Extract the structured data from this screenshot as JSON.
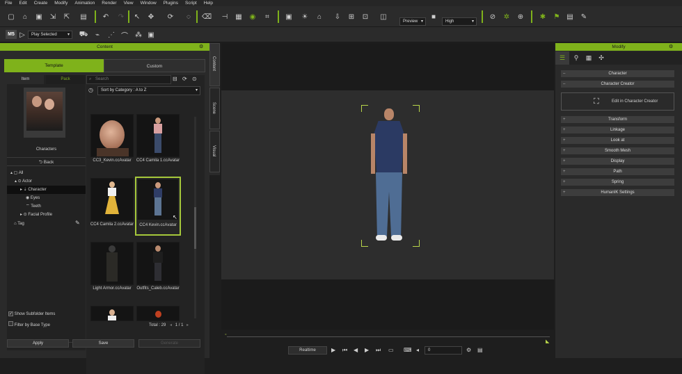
{
  "menu": [
    "File",
    "Edit",
    "Create",
    "Modify",
    "Animation",
    "Render",
    "View",
    "Window",
    "Plugins",
    "Script",
    "Help"
  ],
  "toolbar": {
    "preview_dropdown": "Preview",
    "quality_dropdown": "High",
    "play_selected_dropdown": "Play Selected",
    "logo": "M5"
  },
  "content_panel": {
    "title": "Content",
    "tabs": [
      "Template",
      "Custom"
    ],
    "sub_tabs": [
      "Item",
      "Pack"
    ],
    "preview_caption": "Characters",
    "back_label": "Back",
    "search_placeholder": "Search",
    "sort_dropdown": "Sort by Category : A to Z",
    "tree": [
      "All",
      "Actor",
      "Character",
      "Eyes",
      "Teeth",
      "Facial Profile",
      "Tag"
    ],
    "items": [
      "CC3_Kevin.ccAvatar",
      "CC4 Camila 1.ccAvatar",
      "CC4 Camila 2.ccAvatar",
      "CC4 Kevin.ccAvatar",
      "Light Armor.ccAvatar",
      "Outfits_Caleb.ccAvatar"
    ],
    "show_subfolder": "Show Subfolder Items",
    "filter_base": "Filter by Base Type",
    "total": "Total : 29",
    "page": "1",
    "page_total": "/ 1",
    "buttons": [
      "Apply",
      "Save",
      "Generate"
    ]
  },
  "vertical_tabs": [
    "Content",
    "Scene",
    "Visual"
  ],
  "timeline": {
    "mode": "Realtime",
    "frame": "0"
  },
  "modify_panel": {
    "title": "Modify",
    "sections_top": [
      "Character",
      "Character Creator"
    ],
    "edit_button": "Edit in Character Creator",
    "sections": [
      "Transform",
      "Linkage",
      "Look at",
      "Smooth Mesh",
      "Display",
      "Path",
      "Spring",
      "HumanIK Settings"
    ]
  },
  "colors": {
    "accent": "#7fb21b",
    "panel": "#2a2a2a",
    "selected_item_border": "#a6c83b"
  }
}
